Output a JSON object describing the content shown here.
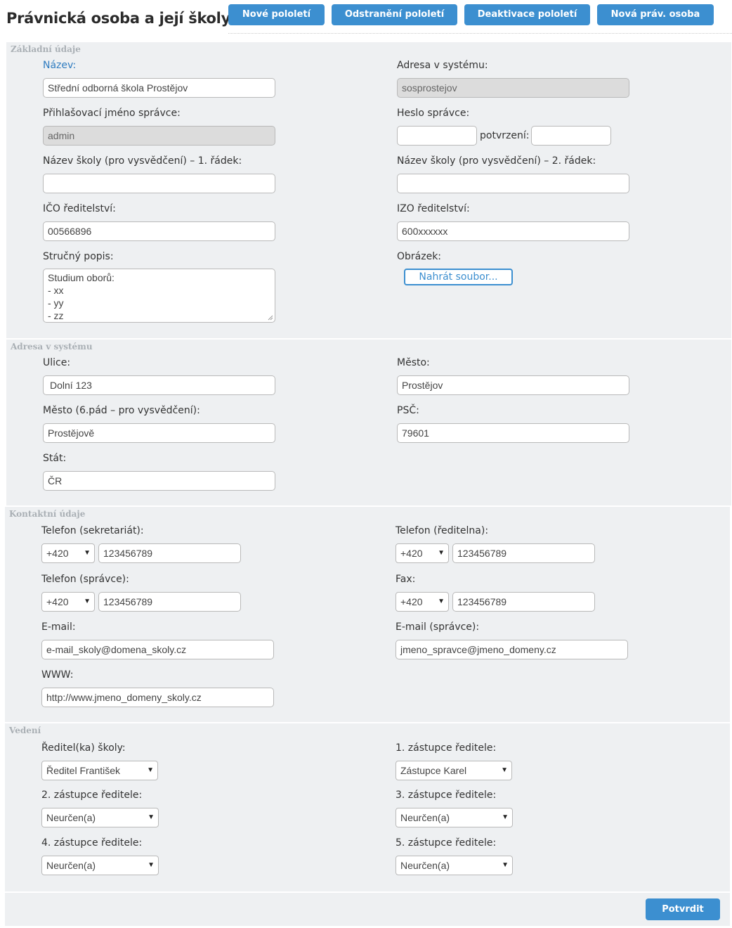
{
  "header": {
    "title": "Právnická osoba a její školy",
    "buttons": [
      "Nové pololetí",
      "Odstranění pololetí",
      "Deaktivace pololetí",
      "Nová práv. osoba"
    ]
  },
  "basic": {
    "section_title": "Základní údaje",
    "name_label": "Název:",
    "name_value": "Střední odborná škola Prostějov",
    "system_address_label": "Adresa v systému:",
    "system_address_value": "sosprostejov",
    "admin_login_label": "Přihlašovací jméno správce:",
    "admin_login_value": "admin",
    "admin_password_label": "Heslo správce:",
    "confirm_label": "potvrzení:",
    "school_name1_label": "Název školy (pro vysvědčení) – 1. řádek:",
    "school_name1_value": "",
    "school_name2_label": "Název školy (pro vysvědčení) – 2. řádek:",
    "school_name2_value": "",
    "ico_label": "IČO ředitelství:",
    "ico_value": "00566896",
    "izo_label": "IZO ředitelství:",
    "izo_value": "600xxxxxx",
    "description_label": "Stručný popis:",
    "description_lines": [
      "Studium oborů:",
      "- xx",
      "- yy",
      "- zz"
    ],
    "image_label": "Obrázek:",
    "upload_label": "Nahrát soubor..."
  },
  "address": {
    "section_title": "Adresa v systému",
    "street_label": "Ulice:",
    "street_value": "Dolní 123",
    "city_label": "Město:",
    "city_value": "Prostějov",
    "city6_label": "Město (6.pád – pro vysvědčení):",
    "city6_value": "Prostějově",
    "zip_label": "PSČ:",
    "zip_value": "79601",
    "country_label": "Stát:",
    "country_value": "ČR"
  },
  "contact": {
    "section_title": "Kontaktní údaje",
    "phone_secretariat_label": "Telefon (sekretariát):",
    "phone_secretariat_prefix": "+420",
    "phone_secretariat_value": "123456789",
    "phone_director_label": "Telefon (ředitelna):",
    "phone_director_prefix": "+420",
    "phone_director_value": "123456789",
    "phone_admin_label": "Telefon (správce):",
    "phone_admin_prefix": "+420",
    "phone_admin_value": "123456789",
    "fax_label": "Fax:",
    "fax_prefix": "+420",
    "fax_value": "123456789",
    "email_label": "E-mail:",
    "email_value": "e-mail_skoly@domena_skoly.cz",
    "email_admin_label": "E-mail (správce):",
    "email_admin_value": "jmeno_spravce@jmeno_domeny.cz",
    "www_label": "WWW:",
    "www_value": "http://www.jmeno_domeny_skoly.cz"
  },
  "management": {
    "section_title": "Vedení",
    "director_label": "Ředitel(ka) školy:",
    "director_value": "Ředitel František",
    "deputy1_label": "1. zástupce ředitele:",
    "deputy1_value": "Zástupce Karel",
    "deputy2_label": "2. zástupce ředitele:",
    "deputy2_value": "Neurčen(a)",
    "deputy3_label": "3. zástupce ředitele:",
    "deputy3_value": "Neurčen(a)",
    "deputy4_label": "4. zástupce ředitele:",
    "deputy4_value": "Neurčen(a)",
    "deputy5_label": "5. zástupce ředitele:",
    "deputy5_value": "Neurčen(a)"
  },
  "footer": {
    "submit_label": "Potvrdit"
  }
}
